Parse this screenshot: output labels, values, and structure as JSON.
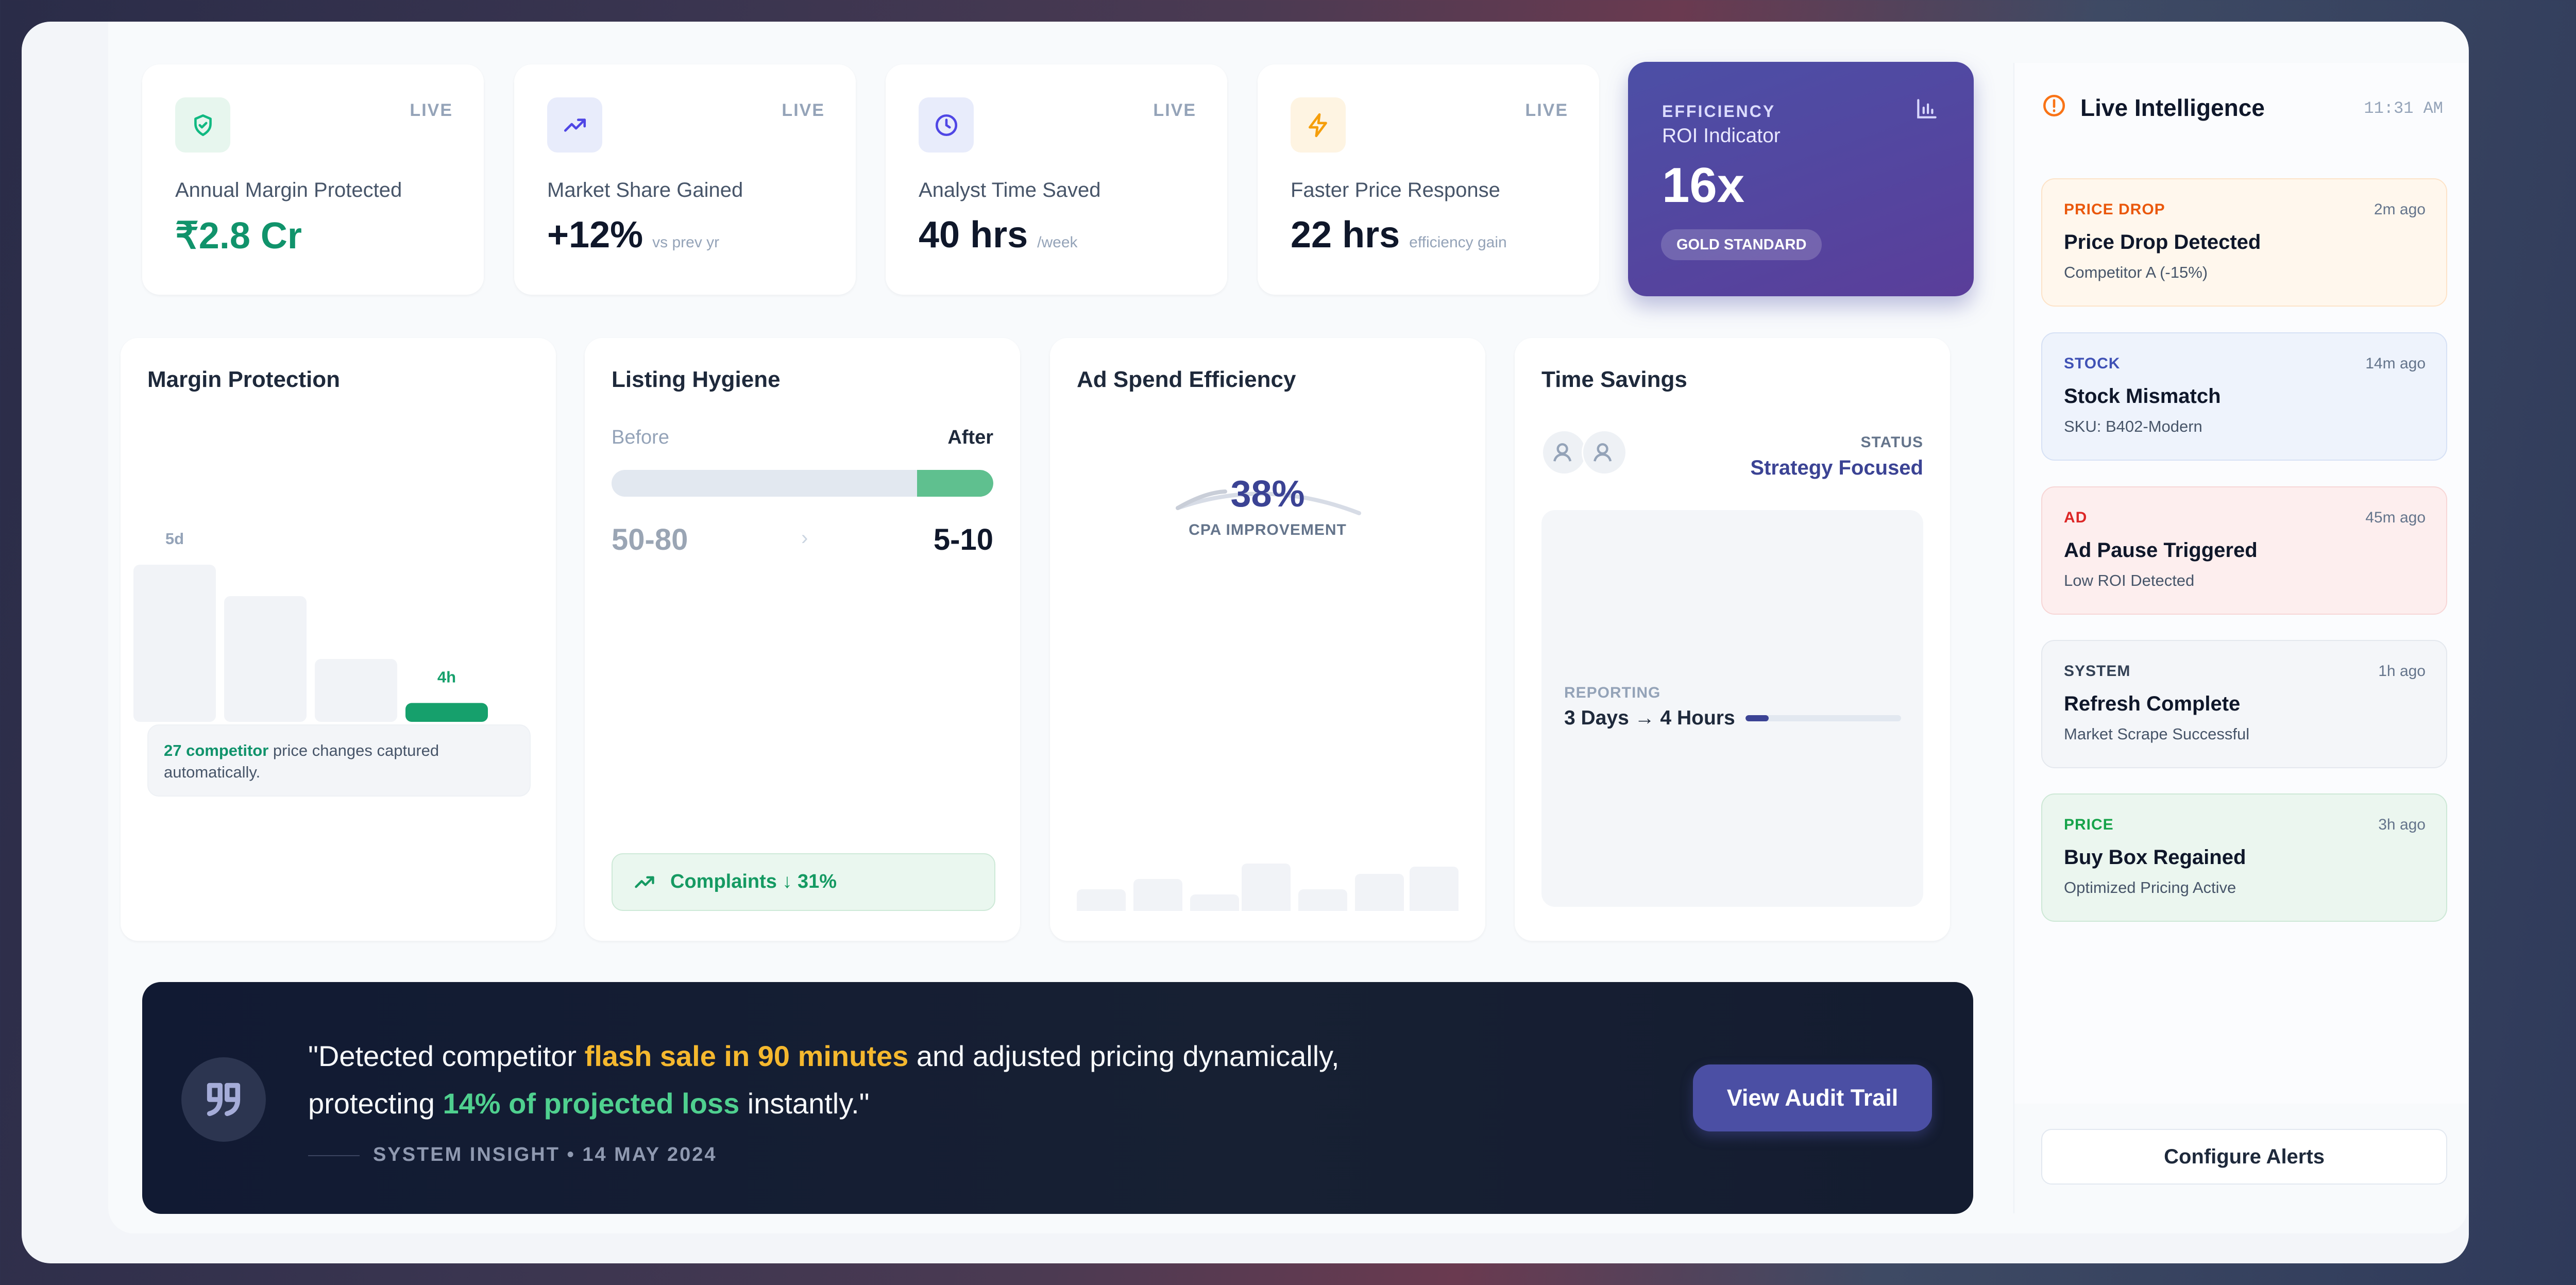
{
  "kpis": [
    {
      "live": "LIVE",
      "label": "Annual Margin Protected",
      "value": "₹2.8 Cr",
      "sub": "",
      "icon": "shield-check-icon",
      "color": "#10b981"
    },
    {
      "live": "LIVE",
      "label": "Market Share Gained",
      "value": "+12%",
      "sub": "vs prev yr",
      "icon": "trend-up-icon",
      "color": "#4f46e5"
    },
    {
      "live": "LIVE",
      "label": "Analyst Time Saved",
      "value": "40 hrs",
      "sub": "/week",
      "icon": "clock-icon",
      "color": "#4f46e5"
    },
    {
      "live": "LIVE",
      "label": "Faster Price Response",
      "value": "22 hrs",
      "sub": "efficiency gain",
      "icon": "bolt-icon",
      "color": "#f59e0b"
    }
  ],
  "roi": {
    "eyebrow": "EFFICIENCY",
    "label": "ROI Indicator",
    "value": "16x",
    "badge": "GOLD STANDARD",
    "icon": "bar-chart-icon"
  },
  "margin": {
    "title": "Margin Protection",
    "chart_data": {
      "type": "bar",
      "categories": [
        "",
        "",
        "",
        ""
      ],
      "values": [
        5,
        4,
        2,
        0.6
      ],
      "labels": [
        "5d",
        "",
        "",
        "4h"
      ]
    },
    "note_bold": "27 competitor",
    "note_rest": " price changes captured automatically."
  },
  "hygiene": {
    "title": "Listing Hygiene",
    "before": "Before",
    "after": "After",
    "before_value": "50-80",
    "after_value": "5-10",
    "fill_fraction": 0.2,
    "complaints": "Complaints ↓ 31%"
  },
  "ad": {
    "title": "Ad Spend Efficiency",
    "value": "38%",
    "caption": "CPA IMPROVEMENT"
  },
  "time": {
    "title": "Time Savings",
    "status_label": "STATUS",
    "status_value": "Strategy Focused",
    "reporting_label": "REPORTING",
    "reporting_value": "3 Days → 4 Hours",
    "progress": 0.15
  },
  "insight": {
    "quote_a": "\"Detected competitor ",
    "quote_hl1": "flash sale in 90 minutes",
    "quote_b": " and adjusted pricing dynamically,",
    "quote_c": "protecting ",
    "quote_hl2": "14% of projected loss",
    "quote_d": " instantly.\"",
    "meta": "SYSTEM INSIGHT • 14 MAY 2024",
    "button": "View Audit Trail"
  },
  "intel": {
    "title": "Live Intelligence",
    "time": "11:31 AM",
    "alerts": [
      {
        "tag": "PRICE DROP",
        "ago": "2m ago",
        "head": "Price Drop Detected",
        "desc": "Competitor A (-15%)",
        "bg": "#fff7ed",
        "border": "#fde3c8",
        "tagColor": "#ea580c"
      },
      {
        "tag": "STOCK",
        "ago": "14m ago",
        "head": "Stock Mismatch",
        "desc": "SKU: B402-Modern",
        "bg": "#eef3fc",
        "border": "#d6e1f5",
        "tagColor": "#3f51b5"
      },
      {
        "tag": "AD",
        "ago": "45m ago",
        "head": "Ad Pause Triggered",
        "desc": "Low ROI Detected",
        "bg": "#fdeeee",
        "border": "#f7d6d6",
        "tagColor": "#dc2626"
      },
      {
        "tag": "SYSTEM",
        "ago": "1h ago",
        "head": "Refresh Complete",
        "desc": "Market Scrape Successful",
        "bg": "#f4f6f9",
        "border": "#e4e8ee",
        "tagColor": "#334155"
      },
      {
        "tag": "PRICE",
        "ago": "3h ago",
        "head": "Buy Box Regained",
        "desc": "Optimized Pricing Active",
        "bg": "#ebf6ef",
        "border": "#cde8d6",
        "tagColor": "#16a34a"
      }
    ],
    "configure": "Configure Alerts"
  }
}
